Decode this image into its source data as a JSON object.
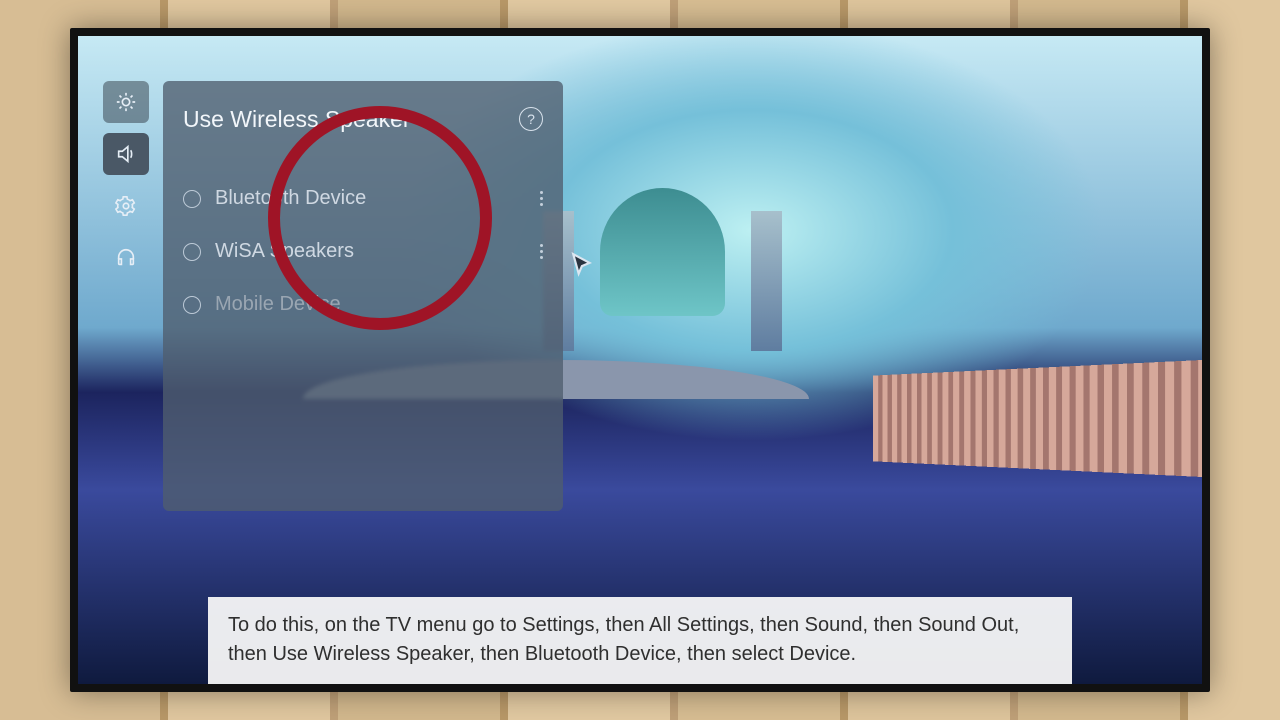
{
  "panel": {
    "title": "Use Wireless Speaker",
    "options": [
      {
        "label": "Bluetooth Device"
      },
      {
        "label": "WiSA Speakers"
      },
      {
        "label": "Mobile Device"
      }
    ]
  },
  "rail": {
    "items": [
      {
        "name": "brightness",
        "active": false
      },
      {
        "name": "sound",
        "active": true
      },
      {
        "name": "settings",
        "active": false
      },
      {
        "name": "support",
        "active": false
      }
    ]
  },
  "caption": "To do this, on the TV menu go to Settings, then All Settings, then Sound, then Sound Out, then Use Wireless Speaker, then Bluetooth Device, then select Device.",
  "help_glyph": "?"
}
